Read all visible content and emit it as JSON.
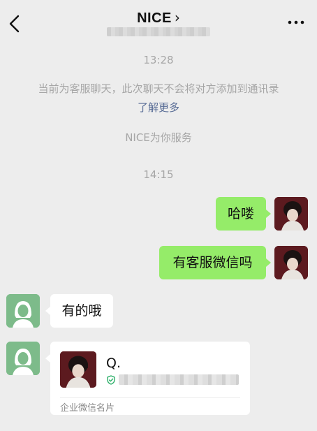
{
  "header": {
    "title": "NICE",
    "title_chevron": "›",
    "back_icon": "chevron-left-icon",
    "more_icon": "more-dots-icon"
  },
  "messages": {
    "time1": "13:28",
    "notice_text": "当前为客服聊天，此次聊天不会将对方添加到通讯录",
    "notice_link": "了解更多",
    "service_text": "NICE为你服务",
    "time2": "14:15",
    "out1": "哈喽",
    "out2": "有客服微信吗",
    "in1": "有的哦"
  },
  "card": {
    "name": "Q.",
    "footer": "企业微信名片",
    "verify_icon": "verified-shield-icon"
  },
  "colors": {
    "background": "#ededed",
    "bubble_out": "#95ec69",
    "bubble_in": "#ffffff",
    "link": "#576b95",
    "system_text": "#a6a6a6"
  }
}
